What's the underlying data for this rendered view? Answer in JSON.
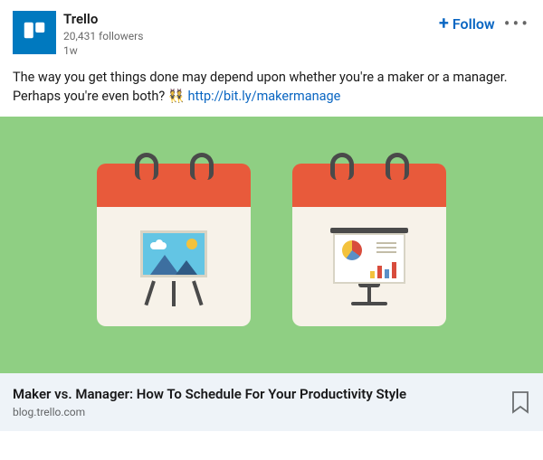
{
  "header": {
    "name": "Trello",
    "followers": "20,431 followers",
    "time": "1w",
    "follow_label": "Follow"
  },
  "body": {
    "text": "The way you get things done may depend upon whether you're a maker or a manager. Perhaps you're even both?",
    "emoji": "👯",
    "link_text": "http://bit.ly/makermanage"
  },
  "link_card": {
    "title": "Maker vs. Manager: How To Schedule For Your Productivity Style",
    "source": "blog.trello.com"
  }
}
